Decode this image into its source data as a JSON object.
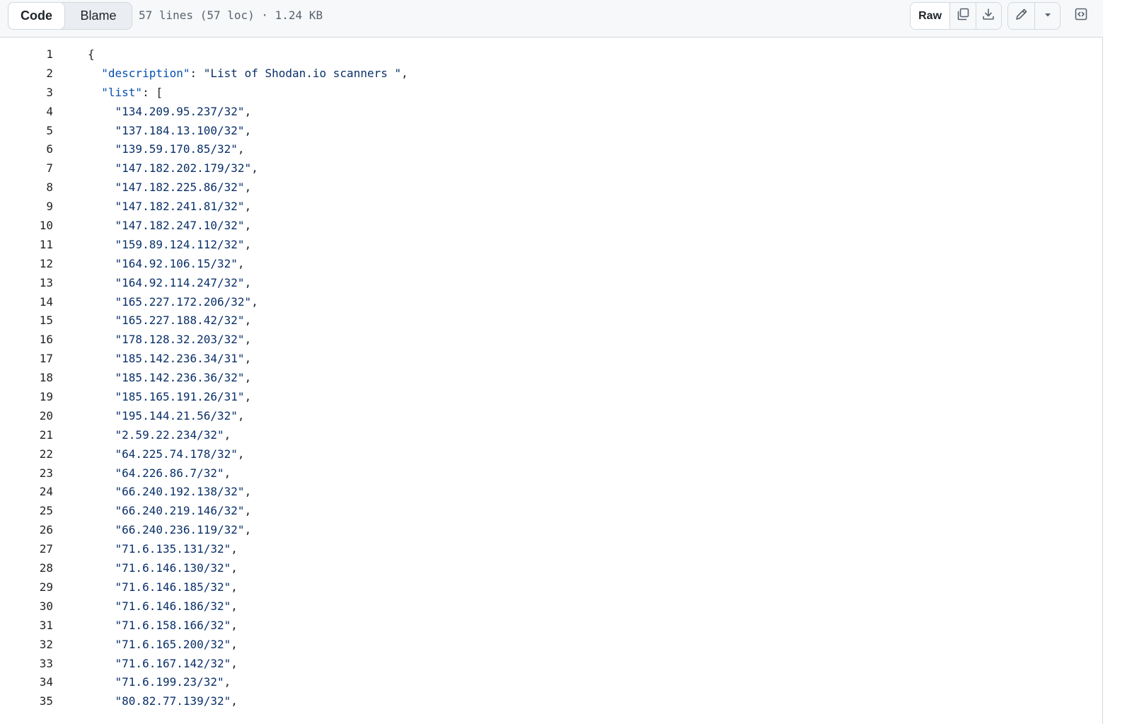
{
  "toolbar": {
    "tabs": [
      {
        "label": "Code",
        "active": true
      },
      {
        "label": "Blame",
        "active": false
      }
    ],
    "file_info": "57 lines (57 loc) · 1.24 KB",
    "raw_label": "Raw",
    "icons": {
      "copy": "copy-icon",
      "download": "download-icon",
      "edit": "pencil-icon",
      "more": "triangle-down-icon",
      "symbols": "code-square-icon"
    }
  },
  "colors": {
    "key": "#0550ae",
    "string": "#0a3069",
    "text": "#1f2328",
    "toolbar_bg": "#f6f8fa",
    "border": "#d1d9e0"
  },
  "code": {
    "lines": [
      {
        "n": "1",
        "indent": "",
        "key": "",
        "value": "{"
      },
      {
        "n": "2",
        "indent": "  ",
        "key": "\"description\"",
        "value": "\"List of Shodan.io scanners \"",
        "tail": ","
      },
      {
        "n": "3",
        "indent": "  ",
        "key": "\"list\"",
        "value": "[",
        "plain_value": true
      },
      {
        "n": "4",
        "indent": "    ",
        "value": "\"134.209.95.237/32\"",
        "tail": ","
      },
      {
        "n": "5",
        "indent": "    ",
        "value": "\"137.184.13.100/32\"",
        "tail": ","
      },
      {
        "n": "6",
        "indent": "    ",
        "value": "\"139.59.170.85/32\"",
        "tail": ","
      },
      {
        "n": "7",
        "indent": "    ",
        "value": "\"147.182.202.179/32\"",
        "tail": ","
      },
      {
        "n": "8",
        "indent": "    ",
        "value": "\"147.182.225.86/32\"",
        "tail": ","
      },
      {
        "n": "9",
        "indent": "    ",
        "value": "\"147.182.241.81/32\"",
        "tail": ","
      },
      {
        "n": "10",
        "indent": "    ",
        "value": "\"147.182.247.10/32\"",
        "tail": ","
      },
      {
        "n": "11",
        "indent": "    ",
        "value": "\"159.89.124.112/32\"",
        "tail": ","
      },
      {
        "n": "12",
        "indent": "    ",
        "value": "\"164.92.106.15/32\"",
        "tail": ","
      },
      {
        "n": "13",
        "indent": "    ",
        "value": "\"164.92.114.247/32\"",
        "tail": ","
      },
      {
        "n": "14",
        "indent": "    ",
        "value": "\"165.227.172.206/32\"",
        "tail": ","
      },
      {
        "n": "15",
        "indent": "    ",
        "value": "\"165.227.188.42/32\"",
        "tail": ","
      },
      {
        "n": "16",
        "indent": "    ",
        "value": "\"178.128.32.203/32\"",
        "tail": ","
      },
      {
        "n": "17",
        "indent": "    ",
        "value": "\"185.142.236.34/31\"",
        "tail": ","
      },
      {
        "n": "18",
        "indent": "    ",
        "value": "\"185.142.236.36/32\"",
        "tail": ","
      },
      {
        "n": "19",
        "indent": "    ",
        "value": "\"185.165.191.26/31\"",
        "tail": ","
      },
      {
        "n": "20",
        "indent": "    ",
        "value": "\"195.144.21.56/32\"",
        "tail": ","
      },
      {
        "n": "21",
        "indent": "    ",
        "value": "\"2.59.22.234/32\"",
        "tail": ","
      },
      {
        "n": "22",
        "indent": "    ",
        "value": "\"64.225.74.178/32\"",
        "tail": ","
      },
      {
        "n": "23",
        "indent": "    ",
        "value": "\"64.226.86.7/32\"",
        "tail": ","
      },
      {
        "n": "24",
        "indent": "    ",
        "value": "\"66.240.192.138/32\"",
        "tail": ","
      },
      {
        "n": "25",
        "indent": "    ",
        "value": "\"66.240.219.146/32\"",
        "tail": ","
      },
      {
        "n": "26",
        "indent": "    ",
        "value": "\"66.240.236.119/32\"",
        "tail": ","
      },
      {
        "n": "27",
        "indent": "    ",
        "value": "\"71.6.135.131/32\"",
        "tail": ","
      },
      {
        "n": "28",
        "indent": "    ",
        "value": "\"71.6.146.130/32\"",
        "tail": ","
      },
      {
        "n": "29",
        "indent": "    ",
        "value": "\"71.6.146.185/32\"",
        "tail": ","
      },
      {
        "n": "30",
        "indent": "    ",
        "value": "\"71.6.146.186/32\"",
        "tail": ","
      },
      {
        "n": "31",
        "indent": "    ",
        "value": "\"71.6.158.166/32\"",
        "tail": ","
      },
      {
        "n": "32",
        "indent": "    ",
        "value": "\"71.6.165.200/32\"",
        "tail": ","
      },
      {
        "n": "33",
        "indent": "    ",
        "value": "\"71.6.167.142/32\"",
        "tail": ","
      },
      {
        "n": "34",
        "indent": "    ",
        "value": "\"71.6.199.23/32\"",
        "tail": ","
      },
      {
        "n": "35",
        "indent": "    ",
        "value": "\"80.82.77.139/32\"",
        "tail": ","
      }
    ]
  }
}
